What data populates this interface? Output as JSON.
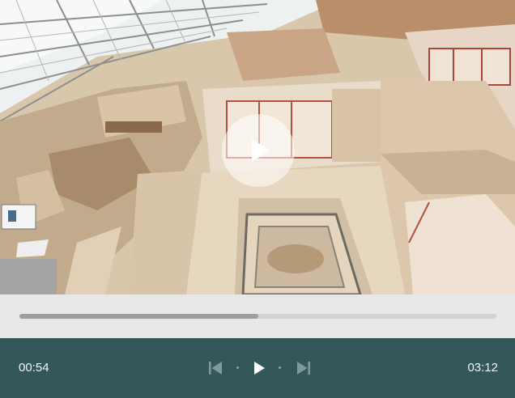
{
  "player": {
    "current_time": "00:54",
    "total_time": "03:12",
    "progress": 0.5,
    "colors": {
      "controls_background": "#34585a",
      "progress_strip_background": "#e8e8e8",
      "progress_track": "#d2d2d2",
      "progress_fill": "#9e9e9e"
    },
    "icons": {
      "big_play": "play-icon",
      "previous": "skip-previous-icon",
      "play": "play-icon",
      "next": "skip-next-icon"
    }
  }
}
